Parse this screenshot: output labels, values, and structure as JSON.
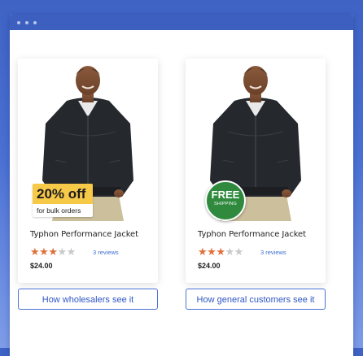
{
  "colors": {
    "brand_blue": "#3d5fbf",
    "star_active": "#e0703a",
    "star_inactive": "#c9c9c9",
    "discount_badge": "#f7c948",
    "free_shipping_badge": "#2f8a3e",
    "button_border": "#4a72d6"
  },
  "products": [
    {
      "name": "Typhon Performance Jacket",
      "rating": 3,
      "rating_max": 5,
      "reviews": "3 reviews",
      "price": "$24.00",
      "badge": {
        "headline": "20% off",
        "subtext": "for bulk orders"
      },
      "cta": "How wholesalers see it"
    },
    {
      "name": "Typhon Performance Jacket",
      "rating": 3,
      "rating_max": 5,
      "reviews": "3 reviews",
      "price": "$24.00",
      "badge": {
        "headline": "FREE",
        "subtext": "SHIPPING"
      },
      "cta": "How general customers see it"
    }
  ]
}
